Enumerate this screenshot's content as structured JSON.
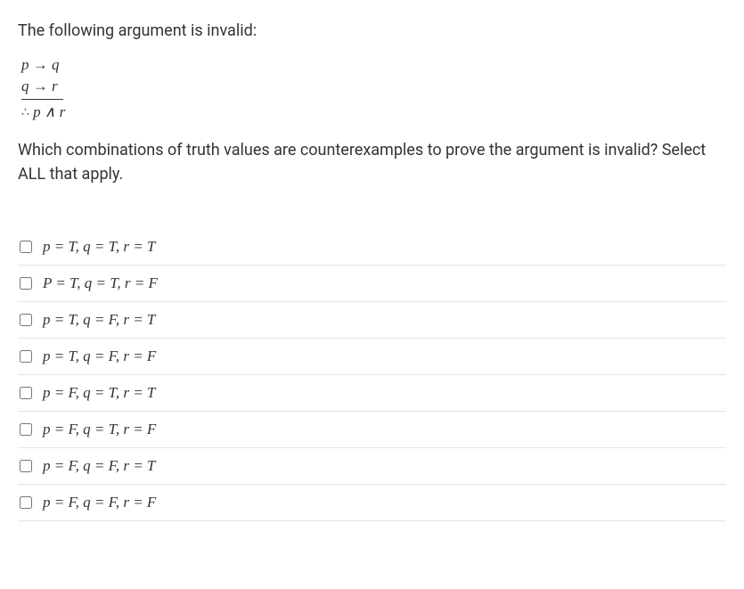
{
  "intro": "The following argument is invalid:",
  "argument": {
    "premise1": "p → q",
    "premise2": "q → r",
    "therefore_symbol": "∴",
    "conclusion": "p ∧ r"
  },
  "question": "Which combinations of truth values are counterexamples to prove the argument is invalid? Select ALL that apply.",
  "options": [
    {
      "text": "p = T, q = T, r = T"
    },
    {
      "text": "P = T, q = T, r = F"
    },
    {
      "text": "p = T, q = F, r = T"
    },
    {
      "text": "p = T, q = F, r = F"
    },
    {
      "text": "p = F, q = T, r = T"
    },
    {
      "text": "p = F, q = T, r = F"
    },
    {
      "text": "p = F, q = F, r = T"
    },
    {
      "text": "p = F, q = F, r = F"
    }
  ]
}
